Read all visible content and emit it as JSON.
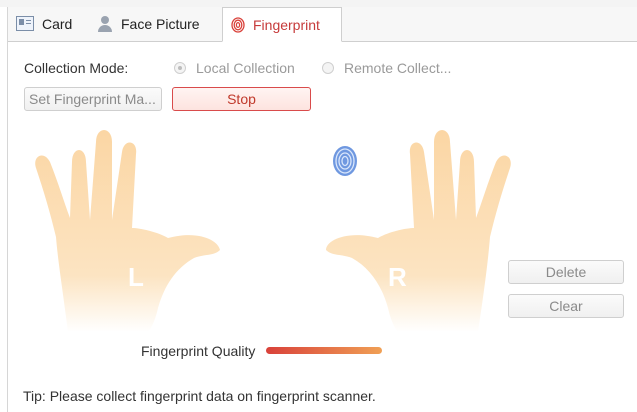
{
  "tabs": [
    {
      "label": "Card",
      "icon": "card-icon",
      "active": false
    },
    {
      "label": "Face Picture",
      "icon": "person-icon",
      "active": false
    },
    {
      "label": "Fingerprint",
      "icon": "fingerprint-icon",
      "active": true
    }
  ],
  "collection": {
    "label": "Collection Mode:",
    "options": [
      {
        "label": "Local Collection",
        "selected": true
      },
      {
        "label": "Remote Collect...",
        "selected": false
      }
    ]
  },
  "buttons": {
    "set_fingerprint": "Set Fingerprint Ma...",
    "stop": "Stop",
    "delete": "Delete",
    "clear": "Clear"
  },
  "hands": {
    "left_letter": "L",
    "right_letter": "R",
    "selected_finger": "right-index-finger"
  },
  "quality": {
    "label": "Fingerprint Quality",
    "level": 1.0
  },
  "tip": "Tip: Please collect fingerprint data on fingerprint scanner.",
  "colors": {
    "accent": "#c63a3a",
    "hand_fill": "#fbd8a8",
    "fingerprint_marker": "#5b86d6"
  }
}
